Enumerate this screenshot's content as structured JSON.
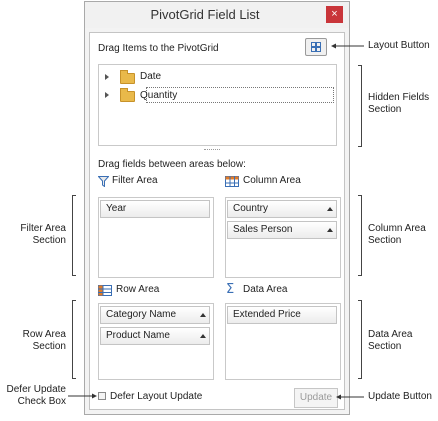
{
  "window": {
    "title": "PivotGrid Field List",
    "close_glyph": "×"
  },
  "panel": {
    "drag_items_label": "Drag Items to the PivotGrid",
    "hidden_fields": [
      "Date",
      "Quantity"
    ],
    "drag_between_label": "Drag fields between areas below:",
    "defer_label": "Defer Layout Update",
    "update_label": "Update"
  },
  "areas": {
    "filter": {
      "title": "Filter Area",
      "fields": [
        "Year"
      ]
    },
    "column": {
      "title": "Column Area",
      "fields": [
        "Country",
        "Sales Person"
      ]
    },
    "row": {
      "title": "Row Area",
      "fields": [
        "Category Name",
        "Product Name"
      ]
    },
    "data": {
      "title": "Data Area",
      "fields": [
        "Extended Price"
      ]
    }
  },
  "annotations": {
    "layout_button": "Layout Button",
    "hidden_fields_1": "Hidden Fields",
    "hidden_fields_2": "Section",
    "filter_area_1": "Filter Area",
    "filter_area_2": "Section",
    "column_area_1": "Column Area",
    "column_area_2": "Section",
    "row_area_1": "Row Area",
    "row_area_2": "Section",
    "data_area_1": "Data Area",
    "data_area_2": "Section",
    "defer_update_1": "Defer Update",
    "defer_update_2": "Check Box",
    "update_button": "Update Button"
  },
  "icons": {
    "folder": "folder-icon",
    "filter": "funnel-icon",
    "column": "table-icon",
    "row": "table-icon",
    "data": "sigma-icon",
    "layout": "layout-grid-icon",
    "sort": "sort-ascending-icon"
  },
  "colors": {
    "close_button": "#c9353a",
    "folder": "#e9b94a",
    "area_icon_orange": "#e07b28",
    "sigma": "#3a6fb5"
  }
}
